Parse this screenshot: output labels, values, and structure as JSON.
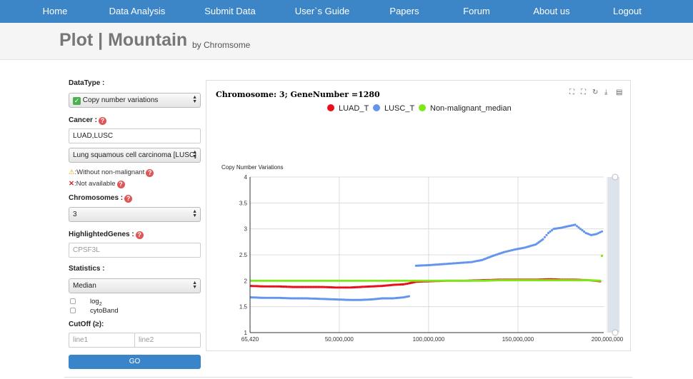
{
  "nav": {
    "items": [
      {
        "label": "Home"
      },
      {
        "label": "Data Analysis"
      },
      {
        "label": "Submit Data"
      },
      {
        "label": "User`s Guide"
      },
      {
        "label": "Papers"
      },
      {
        "label": "Forum"
      },
      {
        "label": "About us"
      },
      {
        "label": "Logout"
      }
    ]
  },
  "header": {
    "title": "Plot | Mountain",
    "subtitle": "by Chromsome"
  },
  "form": {
    "datatype_label": "DataType :",
    "datatype_value": "Copy number variations",
    "cancer_label": "Cancer :",
    "cancer_input": "LUAD,LUSC",
    "cancer_select": "Lung squamous cell carcinoma [LUSC]",
    "note_warning": ":Without non-malignant",
    "note_unavailable": ":Not available",
    "chromosomes_label": "Chromosomes :",
    "chromosome_value": "3",
    "genes_label": "HighlightedGenes :",
    "genes_placeholder": "CPSF3L",
    "statistics_label": "Statistics :",
    "statistics_value": "Median",
    "log_label": "log",
    "log_sub": "2",
    "cytoband_label": "cytoBand",
    "cutoff_label": "CutOff (≥):",
    "line1_placeholder": "line1",
    "line2_placeholder": "line2",
    "go_label": "GO"
  },
  "chart_data": {
    "type": "scatter",
    "title": "Chromosome: 3; GeneNumber =1280",
    "ylabel": "Copy Number Variations",
    "xlabel": "",
    "xlim": [
      65420,
      198000000
    ],
    "ylim": [
      1,
      4
    ],
    "x_ticks": [
      65420,
      50000000,
      100000000,
      150000000,
      200000000
    ],
    "x_tick_labels": [
      "65,420",
      "50,000,000",
      "100,000,000",
      "150,000,000",
      "200,000,000"
    ],
    "y_ticks": [
      1,
      1.5,
      2,
      2.5,
      3,
      3.5,
      4
    ],
    "y_tick_labels": [
      "1",
      "1.5",
      "2",
      "2.5",
      "3",
      "3.5",
      "4"
    ],
    "grid": true,
    "legend_position": "top-center",
    "series": [
      {
        "name": "LUAD_T",
        "color": "#e8101a",
        "points": [
          [
            500000.0,
            1.9
          ],
          [
            8000000.0,
            1.89
          ],
          [
            16000000.0,
            1.89
          ],
          [
            24000000.0,
            1.88
          ],
          [
            32000000.0,
            1.88
          ],
          [
            40000000.0,
            1.88
          ],
          [
            48000000.0,
            1.87
          ],
          [
            56000000.0,
            1.87
          ],
          [
            62000000.0,
            1.88
          ],
          [
            68000000.0,
            1.89
          ],
          [
            74000000.0,
            1.9
          ],
          [
            80000000.0,
            1.92
          ],
          [
            86000000.0,
            1.93
          ],
          [
            89000000.0,
            1.95
          ],
          [
            93000000.0,
            1.98
          ],
          [
            100000000.0,
            1.99
          ],
          [
            110000000.0,
            2.0
          ],
          [
            120000000.0,
            2.0
          ],
          [
            130000000.0,
            2.01
          ],
          [
            140000000.0,
            2.02
          ],
          [
            150000000.0,
            2.02
          ],
          [
            160000000.0,
            2.02
          ],
          [
            168000000.0,
            2.03
          ],
          [
            175000000.0,
            2.02
          ],
          [
            182000000.0,
            2.02
          ],
          [
            190000000.0,
            2.01
          ],
          [
            196000000.0,
            1.99
          ]
        ]
      },
      {
        "name": "LUSC_T",
        "color": "#6495ed",
        "points": [
          [
            500000.0,
            1.68
          ],
          [
            8000000.0,
            1.67
          ],
          [
            16000000.0,
            1.67
          ],
          [
            24000000.0,
            1.66
          ],
          [
            32000000.0,
            1.66
          ],
          [
            40000000.0,
            1.65
          ],
          [
            48000000.0,
            1.64
          ],
          [
            56000000.0,
            1.63
          ],
          [
            62000000.0,
            1.63
          ],
          [
            68000000.0,
            1.64
          ],
          [
            74000000.0,
            1.66
          ],
          [
            80000000.0,
            1.66
          ],
          [
            86000000.0,
            1.68
          ],
          [
            89000000.0,
            1.7
          ],
          [
            93000000.0,
            2.29
          ],
          [
            100000000.0,
            2.3
          ],
          [
            108000000.0,
            2.32
          ],
          [
            116000000.0,
            2.34
          ],
          [
            124000000.0,
            2.36
          ],
          [
            130000000.0,
            2.4
          ],
          [
            136000000.0,
            2.48
          ],
          [
            142000000.0,
            2.55
          ],
          [
            148000000.0,
            2.6
          ],
          [
            154000000.0,
            2.64
          ],
          [
            160000000.0,
            2.7
          ],
          [
            164000000.0,
            2.8
          ],
          [
            167000000.0,
            2.92
          ],
          [
            170000000.0,
            3.0
          ],
          [
            174000000.0,
            3.02
          ],
          [
            178000000.0,
            3.05
          ],
          [
            182000000.0,
            3.08
          ],
          [
            185000000.0,
            3.0
          ],
          [
            188000000.0,
            2.92
          ],
          [
            191000000.0,
            2.88
          ],
          [
            194000000.0,
            2.9
          ],
          [
            197000000.0,
            2.95
          ]
        ]
      },
      {
        "name": "Non-malignant_median",
        "color": "#7ee81a",
        "points": [
          [
            500000.0,
            2.0
          ],
          [
            10000000.0,
            2.0
          ],
          [
            20000000.0,
            2.0
          ],
          [
            30000000.0,
            2.0
          ],
          [
            40000000.0,
            2.0
          ],
          [
            50000000.0,
            2.0
          ],
          [
            60000000.0,
            2.0
          ],
          [
            70000000.0,
            2.0
          ],
          [
            80000000.0,
            2.0
          ],
          [
            90000000.0,
            2.0
          ],
          [
            100000000.0,
            2.0
          ],
          [
            110000000.0,
            2.0
          ],
          [
            120000000.0,
            2.0
          ],
          [
            130000000.0,
            2.0
          ],
          [
            140000000.0,
            2.01
          ],
          [
            150000000.0,
            2.01
          ],
          [
            160000000.0,
            2.01
          ],
          [
            170000000.0,
            2.01
          ],
          [
            180000000.0,
            2.01
          ],
          [
            190000000.0,
            2.01
          ],
          [
            196000000.0,
            2.0
          ],
          [
            197000000.0,
            2.48
          ]
        ]
      }
    ]
  }
}
